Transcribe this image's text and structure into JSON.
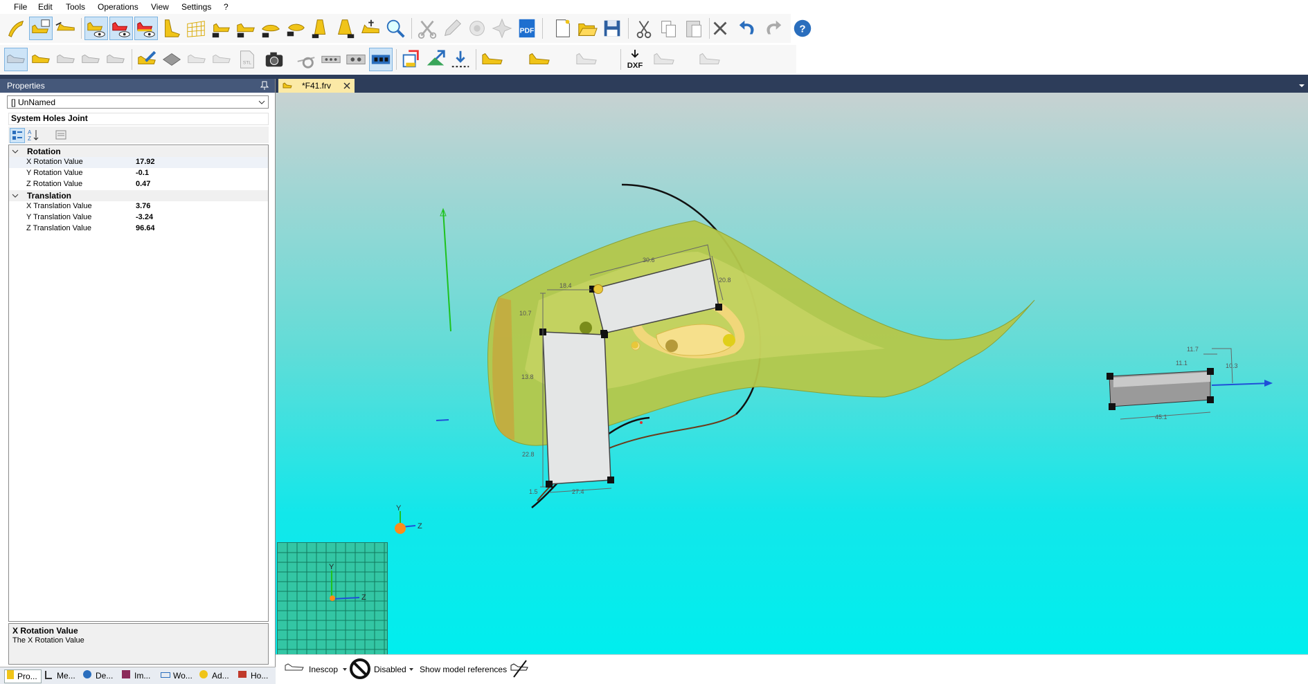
{
  "menu": [
    "File",
    "Edit",
    "Tools",
    "Operations",
    "View",
    "Settings",
    "?"
  ],
  "properties": {
    "title": "Properties",
    "selected_object": "[] UnNamed",
    "object_type": "System Holes Joint",
    "categories": [
      {
        "label": "Rotation",
        "rows": [
          {
            "name": "X Rotation Value",
            "value": "17.92"
          },
          {
            "name": "Y Rotation Value",
            "value": "-0.1"
          },
          {
            "name": "Z Rotation Value",
            "value": "0.47"
          }
        ]
      },
      {
        "label": "Translation",
        "rows": [
          {
            "name": "X Translation Value",
            "value": "3.76"
          },
          {
            "name": "Y Translation Value",
            "value": "-3.24"
          },
          {
            "name": "Z Translation Value",
            "value": "96.64"
          }
        ]
      }
    ],
    "description": {
      "title": "X Rotation Value",
      "text": "The X Rotation Value"
    }
  },
  "bottom_tabs": [
    "Pro...",
    "Me...",
    "De...",
    "Im...",
    "Wo...",
    "Ad...",
    "Ho..."
  ],
  "document_tab": "*F41.frv",
  "toolbar": {
    "dxf_label": "DXF",
    "pdf_label": "PDF",
    "stl_label": "STL",
    "help_label": "?"
  },
  "viewport": {
    "axis_labels": {
      "y": "Y",
      "z": "Z"
    },
    "dimension_labels": [
      "30.6",
      "20.8",
      "18.4",
      "10.7",
      "13.8",
      "22.8",
      "27.4",
      "1.5",
      "11.7",
      "11.1",
      "10.3",
      "45.1"
    ]
  },
  "statusbar": {
    "last_selector": "Inescop",
    "constraint_mode": "Disabled",
    "references_label": "Show model references"
  },
  "colors": {
    "accent": "#45587a",
    "last_green": "#a8c83c",
    "viewport_cyan": "#00eeee",
    "selection_blue": "#cde4f7"
  }
}
